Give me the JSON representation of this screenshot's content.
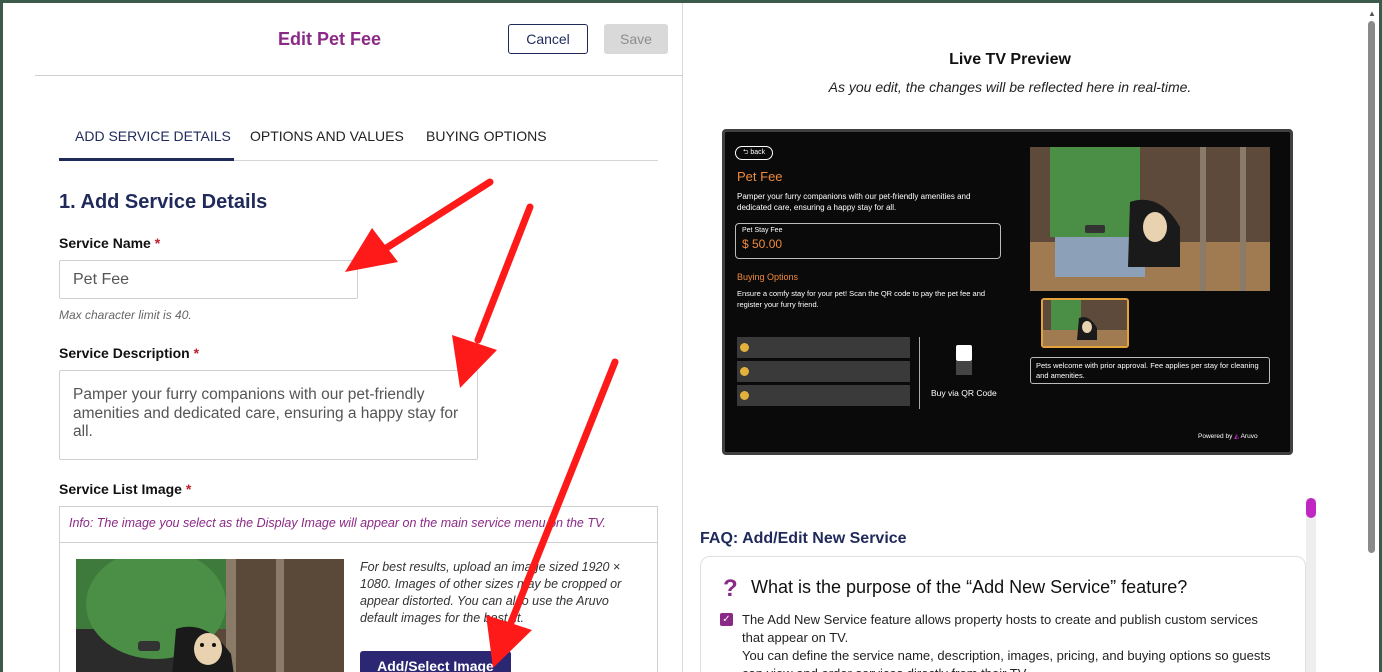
{
  "header": {
    "title": "Edit Pet Fee",
    "cancel_label": "Cancel",
    "save_label": "Save"
  },
  "tabs": [
    {
      "label": "ADD SERVICE DETAILS",
      "active": true
    },
    {
      "label": "OPTIONS AND VALUES",
      "active": false
    },
    {
      "label": "BUYING OPTIONS",
      "active": false
    }
  ],
  "form": {
    "section_title": "1. Add Service Details",
    "service_name": {
      "label": "Service Name",
      "required_mark": "*",
      "value": "Pet Fee",
      "hint": "Max character limit is 40."
    },
    "service_description": {
      "label": "Service Description",
      "required_mark": "*",
      "value": "Pamper your furry companions with our pet-friendly amenities and dedicated care, ensuring a happy stay for all."
    },
    "service_list_image": {
      "label": "Service List Image",
      "required_mark": "*",
      "info": "Info: The image you select as the Display Image will appear on the main service menu on the TV.",
      "tip": "For best results, upload an image sized 1920 × 1080. Images of other sizes may be cropped or appear distorted. You can also use the Aruvo default images for the best fit.",
      "button_label": "Add/Select Image"
    }
  },
  "preview": {
    "title": "Live TV Preview",
    "subtitle": "As you edit, the changes will be reflected here in real-time.",
    "tv": {
      "back_label": "back",
      "service_title": "Pet Fee",
      "description": "Pamper your furry companions with our pet-friendly amenities and dedicated care, ensuring a happy stay for all.",
      "fee_label": "Pet Stay Fee",
      "fee_value": "$ 50.00",
      "buying_title": "Buying Options",
      "buying_desc": "Ensure a comfy stay for your pet! Scan the QR code to pay the pet fee and register your furry friend.",
      "qr_label": "Buy via QR Code",
      "note": "Pets welcome with prior approval. Fee applies per stay for cleaning and amenities.",
      "powered_by": "Powered by",
      "brand": "Aruvo"
    }
  },
  "faq": {
    "title": "FAQ: Add/Edit New Service",
    "question_mark": "?",
    "question": "What is the purpose of the “Add New Service” feature?",
    "answer_1": "The Add New Service feature allows property hosts to create and publish custom services that appear on TV.",
    "answer_2": "You can define the service name, description, images, pricing, and buying options so guests can view and order services directly from their TV."
  },
  "colors": {
    "accent_purple": "#8b2a86",
    "navy": "#1f2a5a",
    "button_navy": "#2b2773",
    "tv_orange": "#f08a3e",
    "annotation_red": "#ff1a1a"
  }
}
